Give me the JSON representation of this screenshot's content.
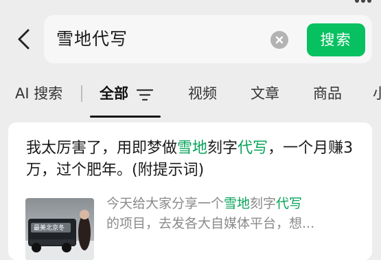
{
  "search": {
    "query": "雪地代写",
    "button_label": "搜索"
  },
  "tabs": [
    {
      "label": "AI 搜索"
    },
    {
      "label": "全部"
    },
    {
      "label": "视频"
    },
    {
      "label": "文章"
    },
    {
      "label": "商品"
    },
    {
      "label": "小"
    }
  ],
  "result": {
    "title_parts": [
      "我太厉害了，用即梦做",
      "雪地",
      "刻字",
      "代写",
      "，一个月赚3万，过个肥年。(附提示词)"
    ],
    "snippet_parts": [
      "今天给大家分享一个",
      "雪地",
      "刻字",
      "代写",
      "的项目，去发各大自媒体平台，想..."
    ],
    "thumbnail_text": "最美北京冬"
  },
  "colors": {
    "accent": "#07c160",
    "highlight": "#07a35a"
  },
  "icons": {
    "back": "chevron-left-icon",
    "clear": "clear-x-icon",
    "filter": "filter-lines-icon"
  }
}
